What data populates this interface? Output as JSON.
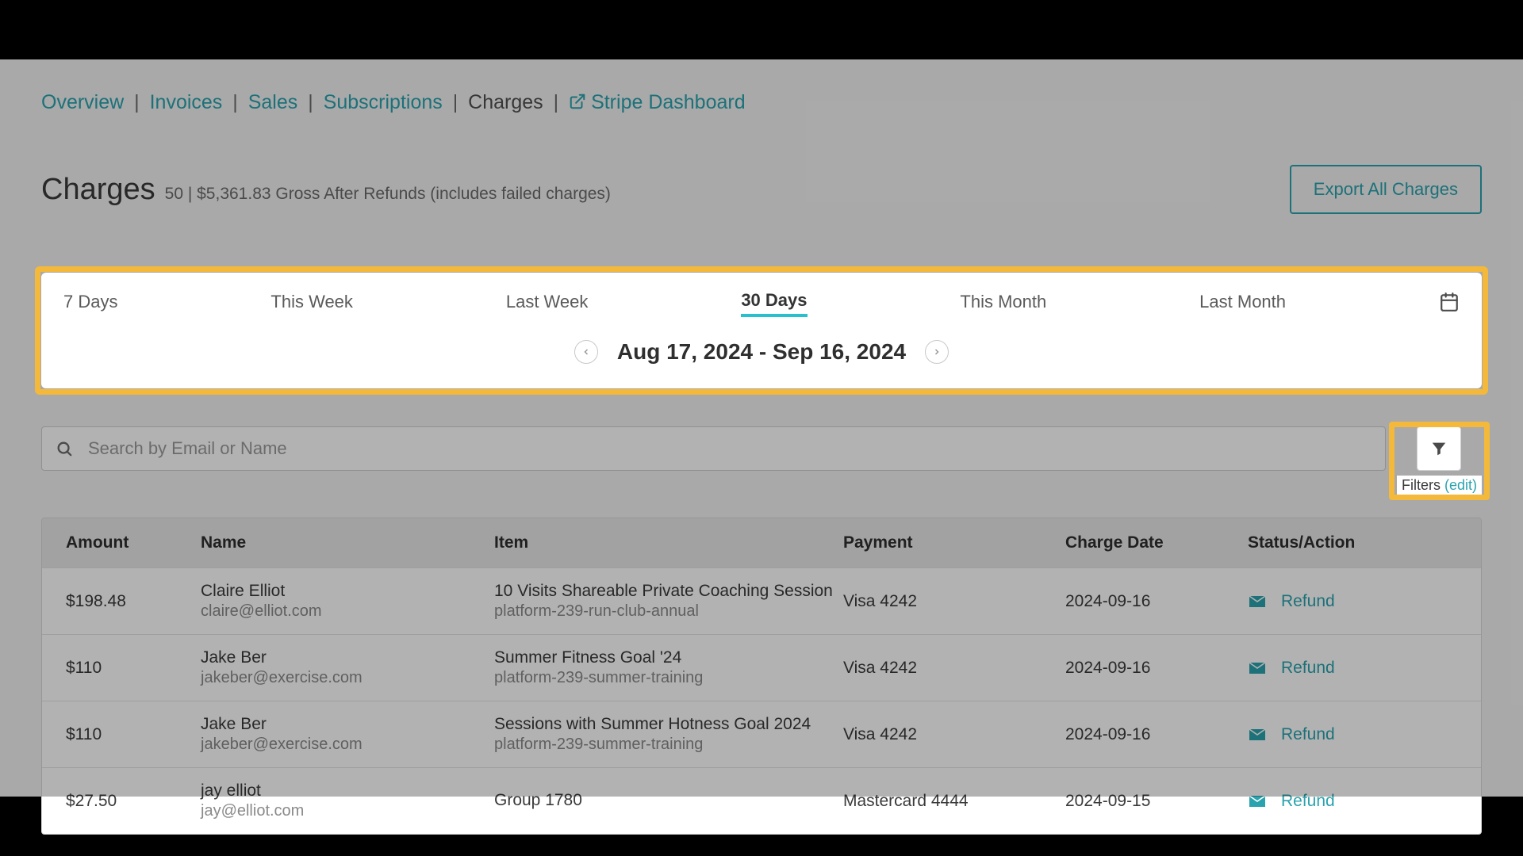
{
  "breadcrumbs": {
    "overview": "Overview",
    "invoices": "Invoices",
    "sales": "Sales",
    "subscriptions": "Subscriptions",
    "charges": "Charges",
    "stripe": "Stripe Dashboard"
  },
  "header": {
    "title": "Charges",
    "count": "50",
    "gross": "$5,361.83 Gross After Refunds (includes failed charges)",
    "export_label": "Export All Charges"
  },
  "range": {
    "tabs": {
      "d7": "7 Days",
      "this_week": "This Week",
      "last_week": "Last Week",
      "d30": "30 Days",
      "this_month": "This Month",
      "last_month": "Last Month"
    },
    "date_text": "Aug 17, 2024 - Sep 16, 2024"
  },
  "search": {
    "placeholder": "Search by Email or Name"
  },
  "filters": {
    "label": "Filters",
    "edit": "(edit)"
  },
  "table": {
    "headers": {
      "amount": "Amount",
      "name": "Name",
      "item": "Item",
      "payment": "Payment",
      "charge_date": "Charge Date",
      "status": "Status/Action"
    },
    "refund_label": "Refund",
    "rows": [
      {
        "amount": "$198.48",
        "name": "Claire Elliot",
        "email": "claire@elliot.com",
        "item": "10 Visits Shareable Private Coaching Session",
        "item_sub": "platform-239-run-club-annual",
        "payment": "Visa 4242",
        "date": "2024-09-16"
      },
      {
        "amount": "$110",
        "name": "Jake Ber",
        "email": "jakeber@exercise.com",
        "item": "Summer Fitness Goal '24",
        "item_sub": "platform-239-summer-training",
        "payment": "Visa 4242",
        "date": "2024-09-16"
      },
      {
        "amount": "$110",
        "name": "Jake Ber",
        "email": "jakeber@exercise.com",
        "item": "Sessions with Summer Hotness Goal 2024",
        "item_sub": "platform-239-summer-training",
        "payment": "Visa 4242",
        "date": "2024-09-16"
      },
      {
        "amount": "$27.50",
        "name": "jay elliot",
        "email": "jay@elliot.com",
        "item": "Group 1780",
        "item_sub": "",
        "payment": "Mastercard 4444",
        "date": "2024-09-15"
      }
    ]
  }
}
